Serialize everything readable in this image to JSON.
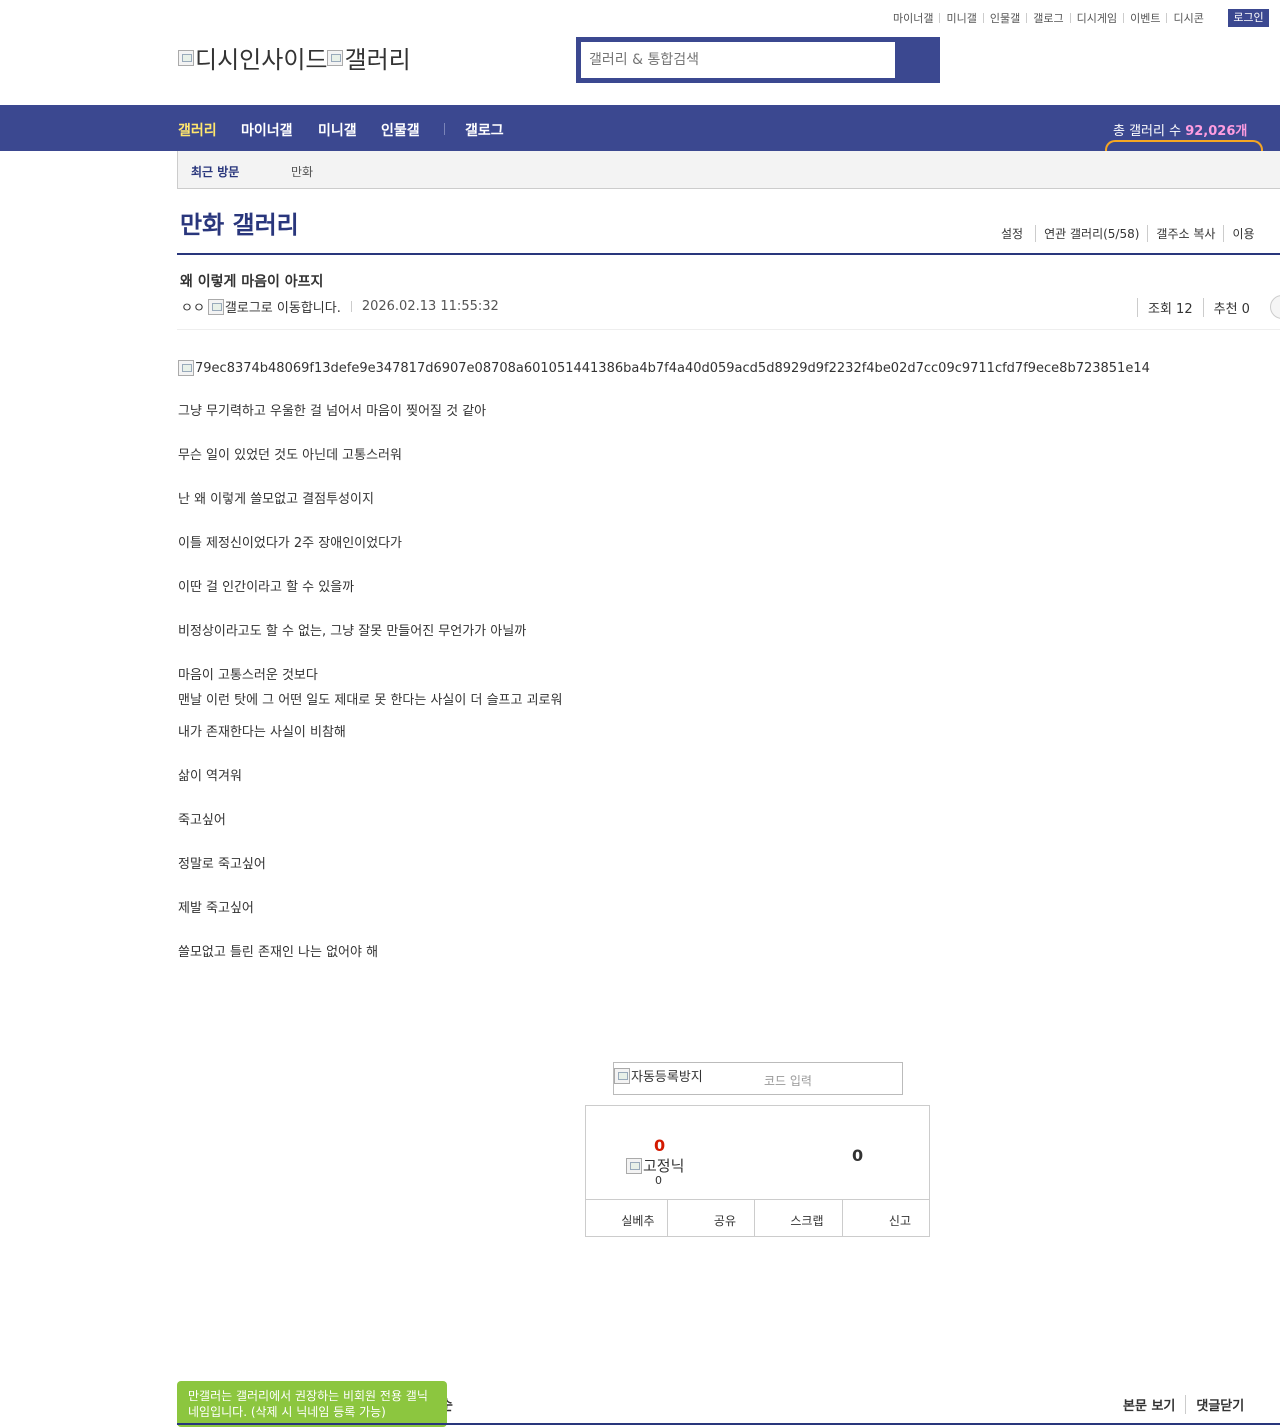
{
  "util_links": [
    "마이너갤",
    "미니갤",
    "인물갤",
    "갤로그",
    "디시게임",
    "이벤트",
    "디시콘"
  ],
  "login_label": "로그인",
  "logo": {
    "alt1": "디시인사이드",
    "alt2": "갤러리"
  },
  "search": {
    "placeholder": "갤러리 & 통합검색"
  },
  "gnb": {
    "items": [
      "갤러리",
      "마이너갤",
      "미니갤",
      "인물갤",
      "갤로그"
    ],
    "total_label": "총 갤러리 수 ",
    "total_value": "92,026개"
  },
  "recent": {
    "label": "최근 방문",
    "items": [
      "만화"
    ]
  },
  "gallery": {
    "title": "만화 갤러리",
    "menu": [
      "설정",
      "연관 갤러리(5/58)",
      "갤주소 복사",
      "이용"
    ]
  },
  "post": {
    "title": "왜 이렇게 마음이 아프지",
    "writer": "ㅇㅇ",
    "gallog_alt": "갤로그로 이동합니다.",
    "date": "2026.02.13 11:55:32",
    "views_label": "조회 12",
    "recommend_label": "추천 0",
    "image_alt": "79ec8374b48069f13defe9e347817d6907e08708a601051441386ba4b7f4a40d059acd5d8929d9f2232f4be02d7cc09c9711cfd7f9ece8b723851e14",
    "lines": [
      "그냥 무기력하고 우울한 걸 넘어서 마음이 찢어질 것 같아",
      "무슨 일이 있었던 것도 아닌데 고통스러워",
      "난 왜 이렇게 쓸모없고 결점투성이지",
      "이틀 제정신이었다가 2주 장애인이었다가",
      "이딴 걸 인간이라고 할 수 있을까",
      "비정상이라고도 할 수 없는, 그냥 잘못 만들어진 무언가가 아닐까",
      "마음이 고통스러운 것보다",
      "맨날 이런 탓에 그 어떤 일도 제대로 못 한다는 사실이 더 슬프고 괴로워",
      "내가 존재한다는 사실이 비참해",
      "삶이 역겨워",
      "죽고싶어",
      "정말로 죽고싶어",
      "제발 죽고싶어",
      "쓸모없고 틀린 존재인 나는 없어야 해"
    ]
  },
  "captcha": {
    "img_alt": "자동등록방지",
    "placeholder": "코드 입력"
  },
  "recommend": {
    "up": "0",
    "fixnick_alt": "고정닉",
    "fixnick_count": "0",
    "down": "0",
    "actions": [
      "실베추",
      "공유",
      "스크랩",
      "신고"
    ]
  },
  "tooltip": "만갤러는 갤러리에서 권장하는 비회원 전용 갤닉네임입니다. (삭제 시 닉네임 등록 가능)",
  "bottom": {
    "fragment": "순",
    "links": [
      "본문 보기",
      "댓글닫기"
    ]
  }
}
